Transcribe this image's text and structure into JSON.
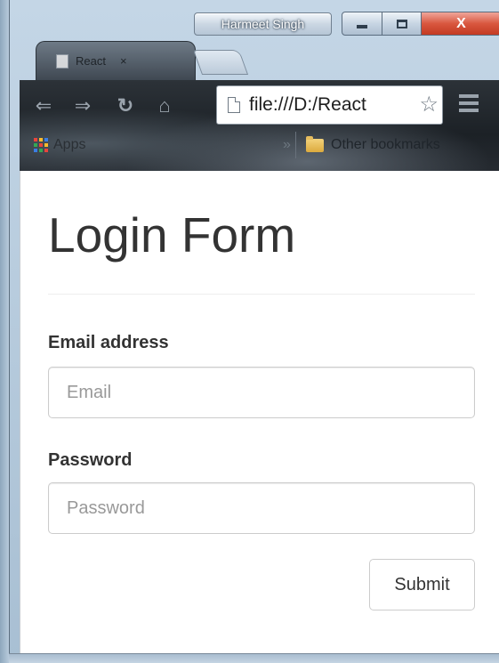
{
  "window": {
    "user_name": "Harmeet Singh",
    "close_glyph": "X"
  },
  "tabs": [
    {
      "title": "React",
      "close_glyph": "×"
    }
  ],
  "toolbar": {
    "back_icon": "arrow-left-icon",
    "forward_icon": "arrow-right-icon",
    "reload_icon": "reload-icon",
    "home_icon": "home-icon",
    "url": "file:///D:/React"
  },
  "bookmarks": {
    "apps_label": "Apps",
    "more_glyph": "»",
    "other_label": "Other bookmarks",
    "apps_colors": [
      "#e8453c",
      "#f9bb2d",
      "#3a7ee4",
      "#34a853",
      "#e8453c",
      "#f9bb2d",
      "#3a7ee4",
      "#34a853",
      "#e8453c"
    ]
  },
  "page": {
    "title": "Login Form",
    "email_label": "Email address",
    "email_placeholder": "Email",
    "email_value": "",
    "password_label": "Password",
    "password_placeholder": "Password",
    "password_value": "",
    "submit_label": "Submit"
  }
}
